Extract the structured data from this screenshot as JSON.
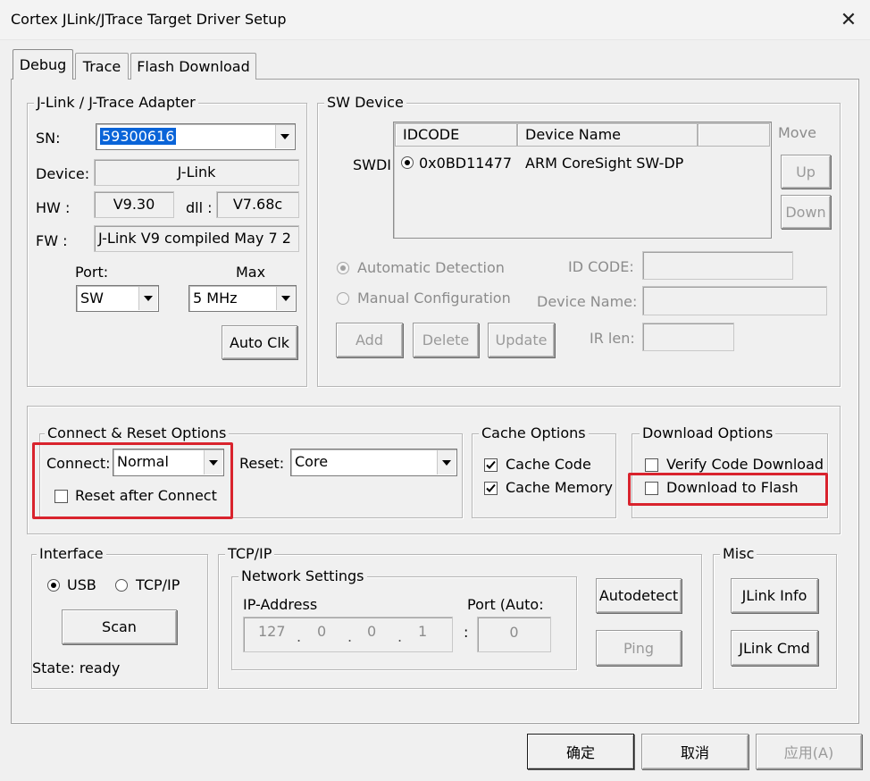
{
  "window": {
    "title": "Cortex JLink/JTrace Target Driver Setup"
  },
  "tabs": [
    "Debug",
    "Trace",
    "Flash Download"
  ],
  "adapter": {
    "group_label": "J-Link / J-Trace Adapter",
    "sn_label": "SN:",
    "sn_value": "59300616",
    "device_label": "Device:",
    "device_value": "J-Link",
    "hw_label": "HW :",
    "hw_value": "V9.30",
    "dll_label": "dll :",
    "dll_value": "V7.68c",
    "fw_label": "FW :",
    "fw_value": "J-Link V9 compiled May  7 2",
    "port_label": "Port:",
    "port_value": "SW",
    "max_label": "Max",
    "max_value": "5 MHz",
    "autoclk_label": "Auto Clk"
  },
  "sw_device": {
    "group_label": "SW Device",
    "swd_label": "SWDI",
    "columns": [
      "IDCODE",
      "Device Name"
    ],
    "rows": [
      {
        "idcode": "0x0BD11477",
        "device_name": "ARM CoreSight SW-DP"
      }
    ],
    "move_label": "Move",
    "up_label": "Up",
    "down_label": "Down",
    "auto_detection_label": "Automatic Detection",
    "manual_config_label": "Manual Configuration",
    "id_code_label": "ID CODE:",
    "device_name_label": "Device Name:",
    "ir_len_label": "IR len:",
    "add_label": "Add",
    "delete_label": "Delete",
    "update_label": "Update"
  },
  "connect_reset": {
    "group_label": "Connect & Reset Options",
    "connect_label": "Connect:",
    "connect_value": "Normal",
    "reset_label": "Reset:",
    "reset_value": "Core",
    "reset_after_connect_label": "Reset after Connect",
    "reset_after_connect_checked": false
  },
  "cache_options": {
    "group_label": "Cache Options",
    "cache_code_label": "Cache Code",
    "cache_code_checked": true,
    "cache_memory_label": "Cache Memory",
    "cache_memory_checked": true
  },
  "download_options": {
    "group_label": "Download Options",
    "verify_label": "Verify Code Download",
    "verify_checked": false,
    "download_flash_label": "Download to Flash",
    "download_flash_checked": false
  },
  "interface": {
    "group_label": "Interface",
    "usb_label": "USB",
    "tcpip_label": "TCP/IP",
    "selected": "USB",
    "scan_label": "Scan",
    "state_text": "State: ready"
  },
  "tcpip": {
    "group_label": "TCP/IP",
    "network_label": "Network Settings",
    "ip_label": "IP-Address",
    "ip_octets": [
      "127",
      "0",
      "0",
      "1"
    ],
    "port_label": "Port (Auto:",
    "port_value": "0",
    "colon": ":",
    "autodetect_label": "Autodetect",
    "ping_label": "Ping"
  },
  "misc": {
    "group_label": "Misc",
    "jlink_info_label": "JLink Info",
    "jlink_cmd_label": "JLink Cmd"
  },
  "footer": {
    "ok_label": "确定",
    "cancel_label": "取消",
    "apply_label": "应用(A)"
  },
  "colors": {
    "highlight": "#d9232d",
    "selection": "#0a64d8"
  }
}
